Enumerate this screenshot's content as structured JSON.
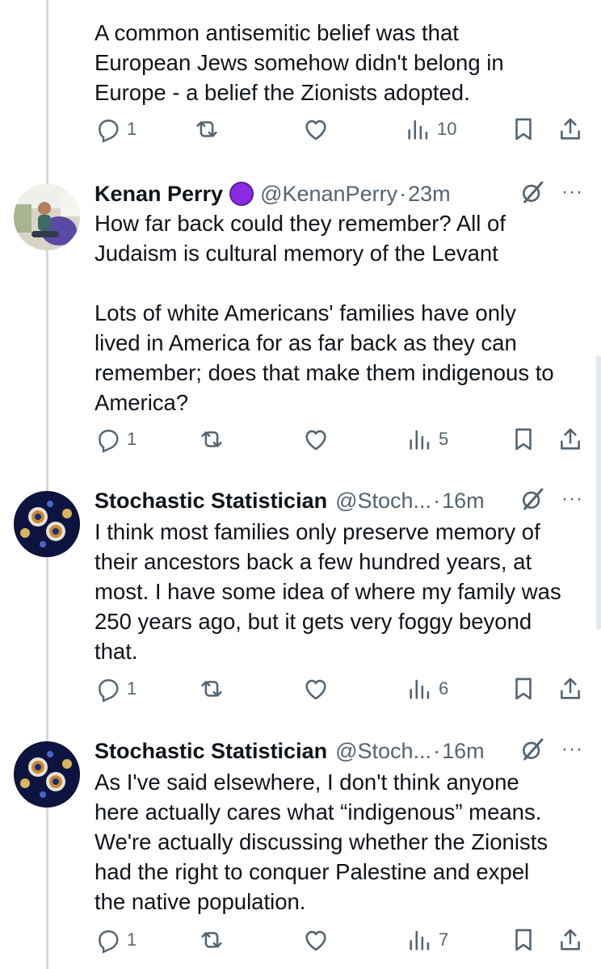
{
  "tweets": [
    {
      "text": "A common antisemitic belief was that\nEuropean Jews somehow didn't belong in\nEurope - a belief the Zionists adopted.",
      "replies": "1",
      "views": "10"
    },
    {
      "name": "Kenan Perry",
      "handle": "@KenanPerry",
      "time": "23m",
      "text": "How far back could they remember? All of\nJudaism is cultural memory of the Levant\n\nLots of white Americans' families have only\nlived in America for as far back as they can\nremember; does that make them indigenous to\nAmerica?",
      "replies": "1",
      "views": "5"
    },
    {
      "name": "Stochastic Statistician",
      "handle": "@Stoch...",
      "time": "16m",
      "text": "I think most families only preserve memory of\ntheir ancestors back a few hundred years, at\nmost. I have some idea of where my family was\n250 years ago, but it gets very foggy beyond\nthat.",
      "replies": "1",
      "views": "6"
    },
    {
      "name": "Stochastic Statistician",
      "handle": "@Stoch...",
      "time": "16m",
      "text": "As I've said elsewhere, I don't think anyone\nhere actually cares what “indigenous” means.\nWe're actually discussing whether the Zionists\nhad the right to conquer Palestine and expel\nthe native population.",
      "replies": "1",
      "views": "7"
    }
  ],
  "icons": {
    "reply": "reply-icon",
    "repost": "repost-icon",
    "like": "like-icon",
    "views": "views-icon",
    "bookmark": "bookmark-icon",
    "share": "share-icon",
    "grok": "grok-icon",
    "more": "more-icon",
    "verified": "purple-circle-badge"
  },
  "colors": {
    "text": "#0f1419",
    "muted": "#536471",
    "thread_line": "#cfd9de",
    "badge": "#8a2be2"
  },
  "separator": "·",
  "more_glyph": "···"
}
